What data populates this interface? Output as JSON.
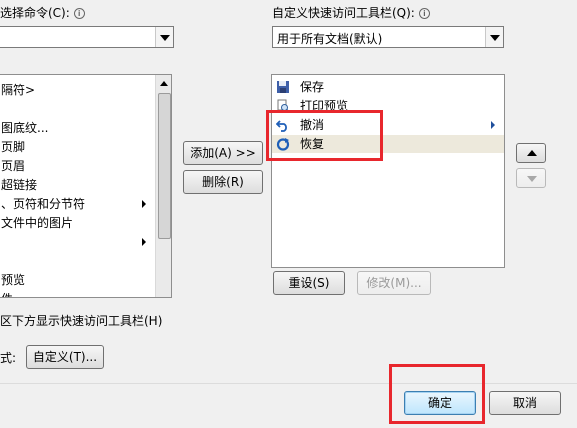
{
  "left_panel": {
    "choose_label": "选择命令(C):",
    "info_icon": "info-icon",
    "items": [
      {
        "label": "隔符>",
        "submenu": false
      },
      {
        "label": "",
        "submenu": false
      },
      {
        "label": "图底纹...",
        "submenu": false
      },
      {
        "label": "页脚",
        "submenu": false
      },
      {
        "label": "页眉",
        "submenu": false
      },
      {
        "label": "超链接",
        "submenu": false
      },
      {
        "label": "、页符和分节符",
        "submenu": true
      },
      {
        "label": "文件中的图片",
        "submenu": false
      },
      {
        "label": "",
        "submenu": true
      },
      {
        "label": "",
        "submenu": false
      },
      {
        "label": "预览",
        "submenu": false
      },
      {
        "label": "件",
        "submenu": false
      }
    ],
    "show_below_label": "区下方显示快速访问工具栏(H)",
    "customize_row_label": "式:",
    "customize_button": "自定义(T)..."
  },
  "right_panel": {
    "title": "自定义快速访问工具栏(Q):",
    "info_icon": "info-icon",
    "scope_value": "用于所有文档(默认)",
    "items": [
      {
        "label": "保存",
        "icon": "save-icon",
        "submenu": false,
        "selected": false
      },
      {
        "label": "打印预览",
        "icon": "print-preview-icon",
        "submenu": false,
        "selected": false
      },
      {
        "label": "撤消",
        "icon": "undo-icon",
        "submenu": true,
        "selected": false
      },
      {
        "label": "恢复",
        "icon": "redo-icon",
        "submenu": false,
        "selected": true
      }
    ],
    "reset_button": "重设(S)",
    "modify_button": "修改(M)..."
  },
  "middle": {
    "add_button": "添加(A) >>",
    "remove_button": "删除(R)"
  },
  "footer": {
    "ok_button": "确定",
    "cancel_button": "取消"
  },
  "colors": {
    "highlight_box": "#e8272d",
    "selected_row": "#ede9dc"
  }
}
